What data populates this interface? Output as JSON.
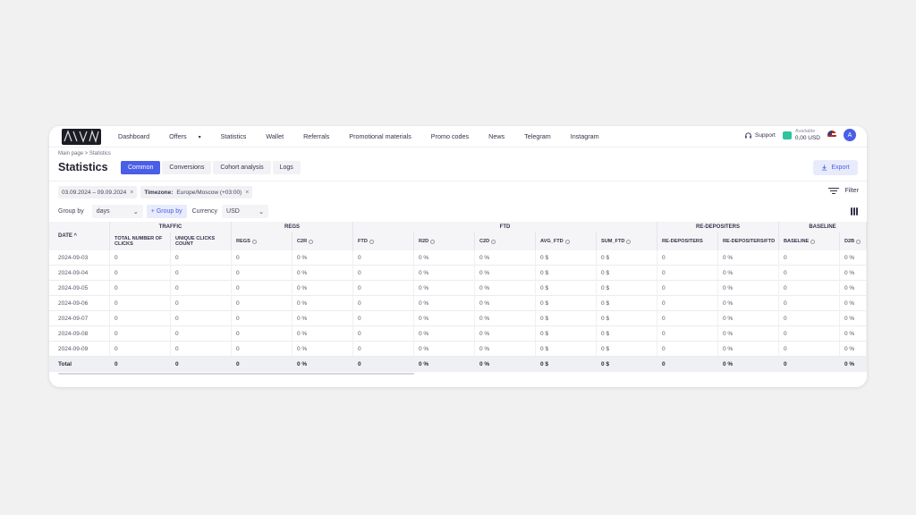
{
  "nav": {
    "items": [
      {
        "label": "Dashboard",
        "style": ""
      },
      {
        "label": "Offers",
        "style": "",
        "dropdown": true
      },
      {
        "label": "Statistics",
        "style": "active"
      },
      {
        "label": "Wallet",
        "style": ""
      },
      {
        "label": "Referrals",
        "style": ""
      },
      {
        "label": "Promotional materials",
        "style": ""
      },
      {
        "label": "Promo codes",
        "style": ""
      },
      {
        "label": "News",
        "style": ""
      },
      {
        "label": "Telegram",
        "style": "link"
      },
      {
        "label": "Instagram",
        "style": "link2"
      }
    ],
    "support": "Support",
    "wallet_label": "Available",
    "wallet_amount": "0,00 USD",
    "avatar": "A"
  },
  "breadcrumb": "Main page > Statistics",
  "title": "Statistics",
  "tabs": [
    "Common",
    "Conversions",
    "Cohort analysis",
    "Logs"
  ],
  "active_tab": 0,
  "export_label": "Export",
  "chips": [
    {
      "label": "",
      "value": "03.09.2024 – 09.09.2024"
    },
    {
      "label": "Timezone:",
      "value": "Europe/Moscow (+03:00)"
    }
  ],
  "filter_label": "Filter",
  "controls": {
    "group_by_label": "Group by",
    "group_by_value": "days",
    "add_group_label": "+ Group by",
    "currency_label": "Currency",
    "currency_value": "USD"
  },
  "table": {
    "date_header": "DATE ^",
    "groups": [
      "TRAFFIC",
      "REGS",
      "FTD",
      "RE-DEPOSITERS",
      "BASELINE"
    ],
    "columns": [
      {
        "label": "TOTAL NUMBER OF CLICKS",
        "info": false
      },
      {
        "label": "UNIQUE CLICKS COUNT",
        "info": false
      },
      {
        "label": "REGS",
        "info": true
      },
      {
        "label": "C2R",
        "info": true
      },
      {
        "label": "FTD",
        "info": true
      },
      {
        "label": "R2D",
        "info": true
      },
      {
        "label": "C2D",
        "info": true
      },
      {
        "label": "AVG_FTD",
        "info": true
      },
      {
        "label": "SUM_FTD",
        "info": true
      },
      {
        "label": "RE-DEPOSITERS",
        "info": false
      },
      {
        "label": "RE-DEPOSITERS/FTD",
        "info": false
      },
      {
        "label": "BASELINE",
        "info": true
      },
      {
        "label": "D2B",
        "info": true
      }
    ],
    "rows": [
      {
        "date": "2024-09-03",
        "values": [
          "0",
          "0",
          "0",
          "0 %",
          "0",
          "0 %",
          "0 %",
          "0 $",
          "0 $",
          "0",
          "0 %",
          "0",
          "0 %"
        ]
      },
      {
        "date": "2024-09-04",
        "values": [
          "0",
          "0",
          "0",
          "0 %",
          "0",
          "0 %",
          "0 %",
          "0 $",
          "0 $",
          "0",
          "0 %",
          "0",
          "0 %"
        ]
      },
      {
        "date": "2024-09-05",
        "values": [
          "0",
          "0",
          "0",
          "0 %",
          "0",
          "0 %",
          "0 %",
          "0 $",
          "0 $",
          "0",
          "0 %",
          "0",
          "0 %"
        ]
      },
      {
        "date": "2024-09-06",
        "values": [
          "0",
          "0",
          "0",
          "0 %",
          "0",
          "0 %",
          "0 %",
          "0 $",
          "0 $",
          "0",
          "0 %",
          "0",
          "0 %"
        ]
      },
      {
        "date": "2024-09-07",
        "values": [
          "0",
          "0",
          "0",
          "0 %",
          "0",
          "0 %",
          "0 %",
          "0 $",
          "0 $",
          "0",
          "0 %",
          "0",
          "0 %"
        ]
      },
      {
        "date": "2024-09-08",
        "values": [
          "0",
          "0",
          "0",
          "0 %",
          "0",
          "0 %",
          "0 %",
          "0 $",
          "0 $",
          "0",
          "0 %",
          "0",
          "0 %"
        ]
      },
      {
        "date": "2024-09-09",
        "values": [
          "0",
          "0",
          "0",
          "0 %",
          "0",
          "0 %",
          "0 %",
          "0 $",
          "0 $",
          "0",
          "0 %",
          "0",
          "0 %"
        ]
      }
    ],
    "total": {
      "date": "Total",
      "values": [
        "0",
        "0",
        "0",
        "0 %",
        "0",
        "0 %",
        "0 %",
        "0 $",
        "0 $",
        "0",
        "0 %",
        "0",
        "0 %"
      ]
    }
  },
  "colors": {
    "accent": "#4a5ee8",
    "wallet": "#2fc49a"
  }
}
